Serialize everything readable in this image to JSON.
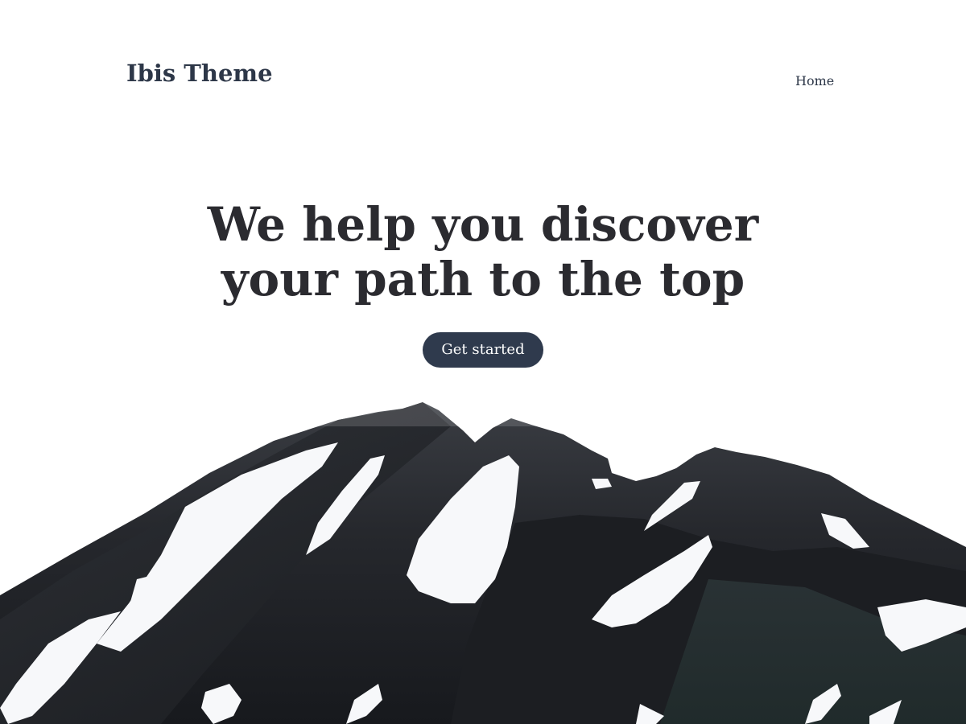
{
  "header": {
    "site_title": "Ibis Theme",
    "nav": [
      {
        "label": "Home"
      }
    ]
  },
  "hero": {
    "heading_line1": "We help you discover",
    "heading_line2": "your path to the top",
    "cta_label": "Get started"
  },
  "colors": {
    "title_text": "#2d3748",
    "heading_text": "#2b2b30",
    "button_bg": "#2f3a4d",
    "button_text": "#ffffff",
    "mountain_rock": "#1f2126",
    "snow": "#f7f8fa"
  },
  "image": {
    "subject": "snow-dusted-dark-mountain-illustration"
  }
}
